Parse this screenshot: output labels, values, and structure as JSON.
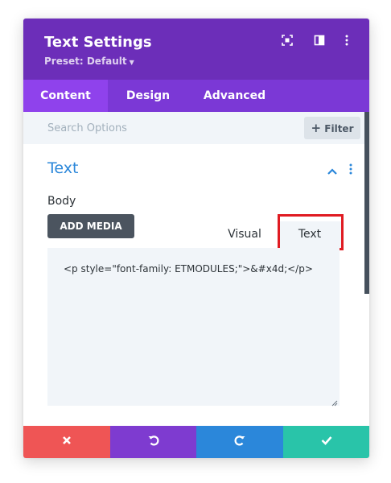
{
  "header": {
    "title": "Text Settings",
    "preset_label": "Preset: Default",
    "icons": [
      "fullscreen-icon",
      "split-view-icon",
      "more-menu-icon"
    ]
  },
  "tabs": [
    {
      "label": "Content",
      "active": true
    },
    {
      "label": "Design",
      "active": false
    },
    {
      "label": "Advanced",
      "active": false
    }
  ],
  "search": {
    "placeholder": "Search Options",
    "filter_label": "Filter"
  },
  "section": {
    "title": "Text",
    "expanded": true
  },
  "body_field": {
    "label": "Body",
    "add_media_label": "ADD MEDIA",
    "editor_tabs": [
      {
        "label": "Visual",
        "active": false
      },
      {
        "label": "Text",
        "active": true
      }
    ],
    "content": "<p style=\"font-family: ETMODULES;\">&#x4d;</p>"
  },
  "footer": {
    "buttons": [
      {
        "name": "cancel",
        "icon": "close-icon",
        "color": "#ef5555"
      },
      {
        "name": "undo",
        "icon": "undo-icon",
        "color": "#7e3bd0"
      },
      {
        "name": "redo",
        "icon": "redo-icon",
        "color": "#2b87da"
      },
      {
        "name": "save",
        "icon": "check-icon",
        "color": "#29c4a9"
      }
    ]
  },
  "colors": {
    "header": "#6c2eb9",
    "tabs_bar": "#7b38d6",
    "tab_active": "#8f42ec",
    "section_title": "#2b87da",
    "annotation_box": "#e01b22"
  }
}
